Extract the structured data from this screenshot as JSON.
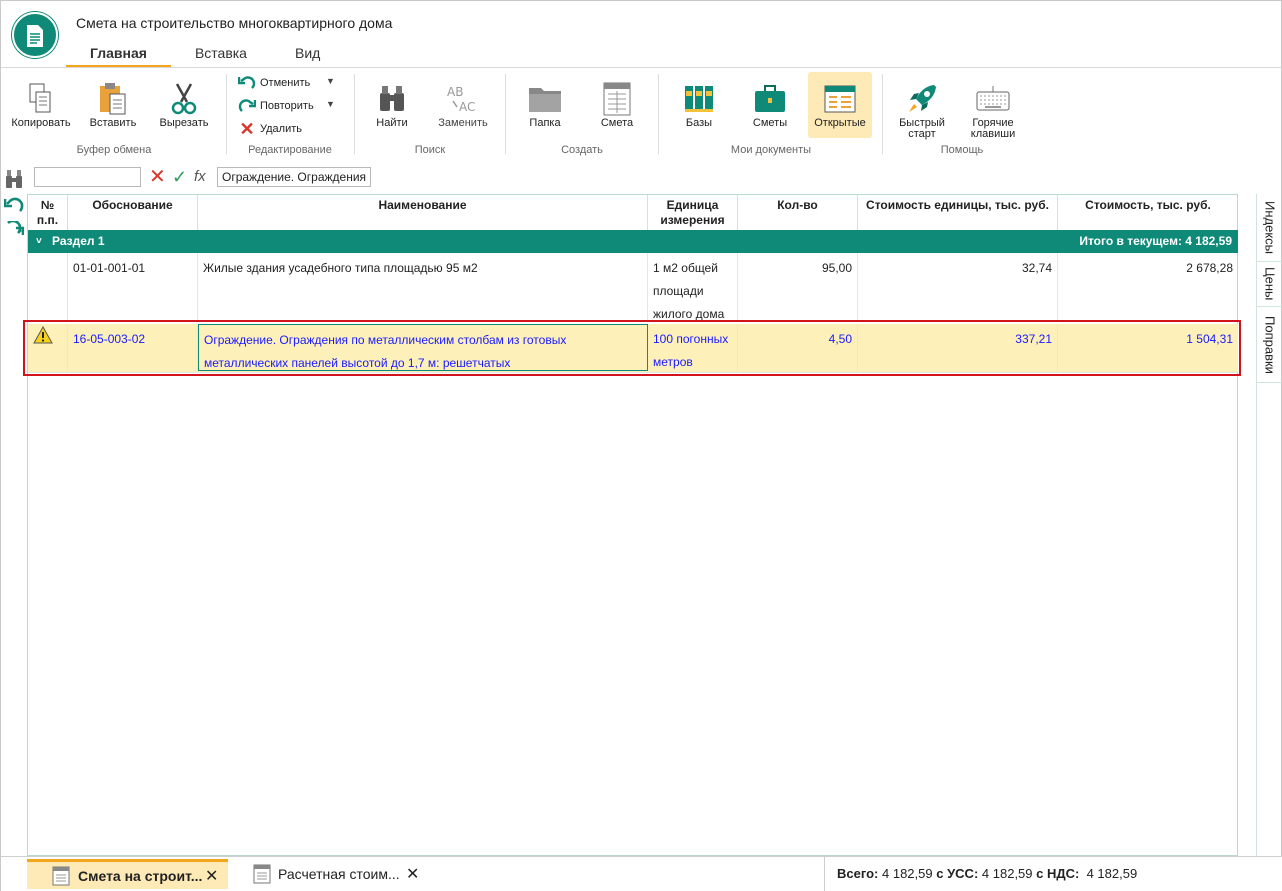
{
  "app": {
    "title": "Смета на строительство многоквартирного дома",
    "tabs": [
      "Главная",
      "Вставка",
      "Вид"
    ]
  },
  "ribbon": {
    "clipboard": {
      "label": "Буфер обмена",
      "copy": "Копировать",
      "paste": "Вставить",
      "cut": "Вырезать"
    },
    "editing": {
      "label": "Редактирование",
      "undo": "Отменить",
      "redo": "Повторить",
      "delete": "Удалить"
    },
    "search": {
      "label": "Поиск",
      "find": "Найти",
      "replace": "Заменить"
    },
    "create": {
      "label": "Создать",
      "folder": "Папка",
      "estimate": "Смета"
    },
    "mydocs": {
      "label": "Мои документы",
      "bases": "Базы",
      "estimates": "Сметы",
      "open": "Открытые"
    },
    "help": {
      "label": "Помощь",
      "quick_start_1": "Быстрый",
      "quick_start_2": "старт",
      "hotkeys_1": "Горячие",
      "hotkeys_2": "клавиши"
    }
  },
  "formula_bar": {
    "cell_ref": "",
    "value": "Ограждение. Ограждения"
  },
  "grid": {
    "headers": {
      "num_1": "№",
      "num_2": "п.п.",
      "basis": "Обоснование",
      "name": "Наименование",
      "unit_1": "Единица",
      "unit_2": "измерения",
      "qty": "Кол-во",
      "unit_cost": "Стоимость единицы, тыс. руб.",
      "cost": "Стоимость, тыс. руб."
    },
    "section": {
      "name": "Раздел 1",
      "total": "Итого в текущем: 4 182,59"
    },
    "rows": [
      {
        "basis": "01-01-001-01",
        "name": "Жилые здания усадебного типа площадью 95 м2",
        "unit_1": "1 м2 общей",
        "unit_2": "площади",
        "unit_3": "жилого дома",
        "qty": "95,00",
        "unit_cost": "32,74",
        "cost": "2 678,28"
      },
      {
        "basis": "16-05-003-02",
        "name_1": "Ограждение. Ограждения по металлическим столбам из готовых",
        "name_2": "металлических панелей высотой до 1,7 м: решетчатых",
        "unit_1": "100 погонных",
        "unit_2": "метров",
        "qty": "4,50",
        "unit_cost": "337,21",
        "cost": "1 504,31",
        "warning": true
      }
    ]
  },
  "side_tabs": [
    "Индексы",
    "Цены",
    "Поправки"
  ],
  "bottom": {
    "tabs": [
      "Смета на строит...",
      "Расчетная стоим..."
    ],
    "total_label": "Всего:",
    "total": "4 182,59",
    "uss_label": "с УСС:",
    "uss": "4 182,59",
    "vat_label": "с НДС:",
    "vat": "4 182,59"
  },
  "colors": {
    "accent": "#0f8a78",
    "highlight": "#fdf0b9",
    "tab_underline": "#f3a51d",
    "selection": "#d1141c"
  }
}
